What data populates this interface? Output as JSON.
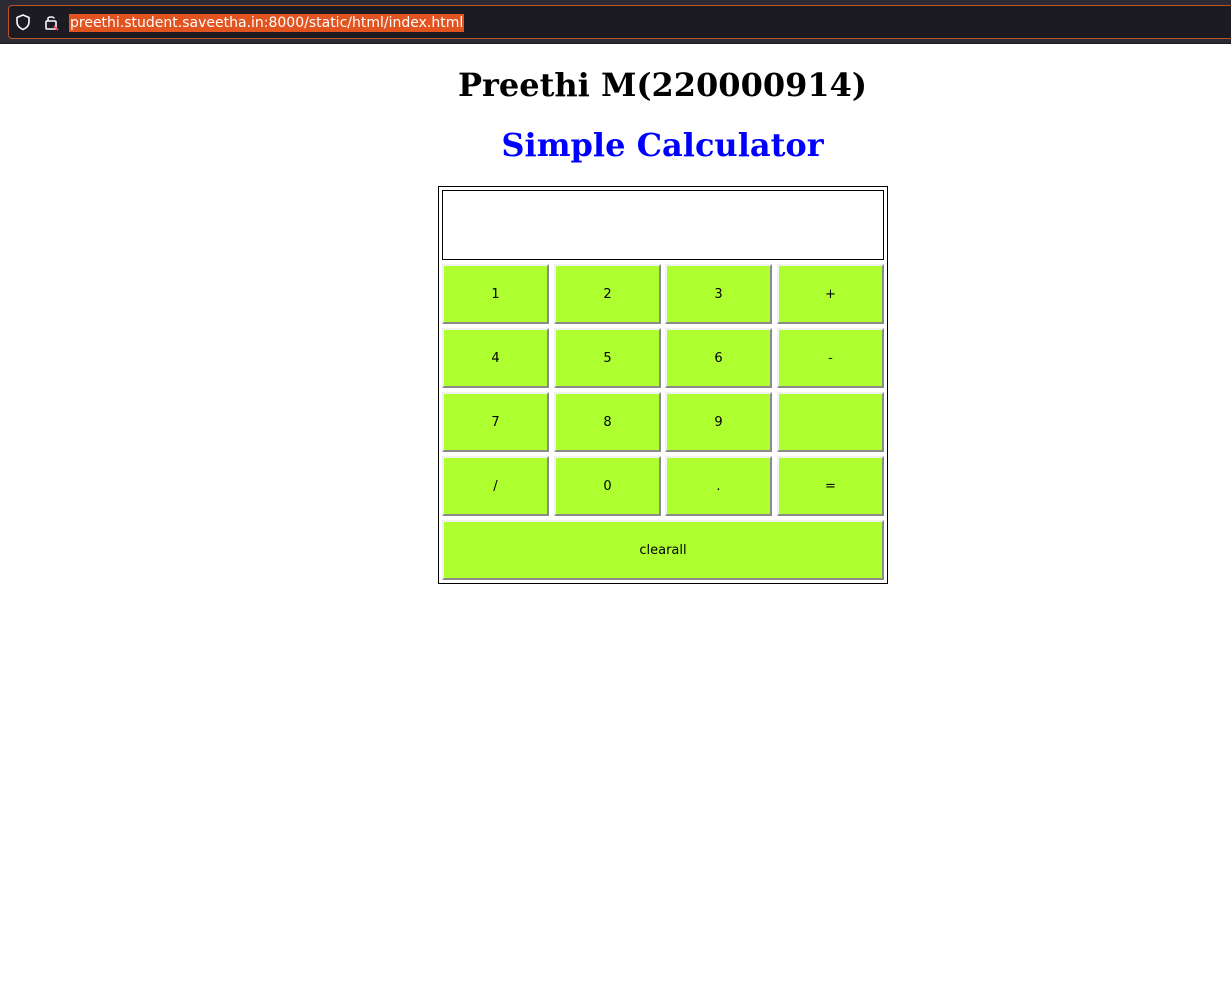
{
  "browser": {
    "url": "preethi.student.saveetha.in:8000/static/html/index.html",
    "icons": [
      "shield-icon",
      "lock-icon"
    ],
    "url_highlight_color": "#e1531f"
  },
  "page": {
    "student_heading": "Preethi M(220000914)",
    "title": "Simple Calculator",
    "title_color": "#0000ff"
  },
  "calculator": {
    "display_value": "",
    "button_color": "#adff2f",
    "keys": {
      "k1": "1",
      "k2": "2",
      "k3": "3",
      "plus": "+",
      "k4": "4",
      "k5": "5",
      "k6": "6",
      "minus": "-",
      "k7": "7",
      "k8": "8",
      "k9": "9",
      "blank": "",
      "divide": "/",
      "k0": "0",
      "dot": ".",
      "equals": "=",
      "clearall": "clearall"
    }
  }
}
